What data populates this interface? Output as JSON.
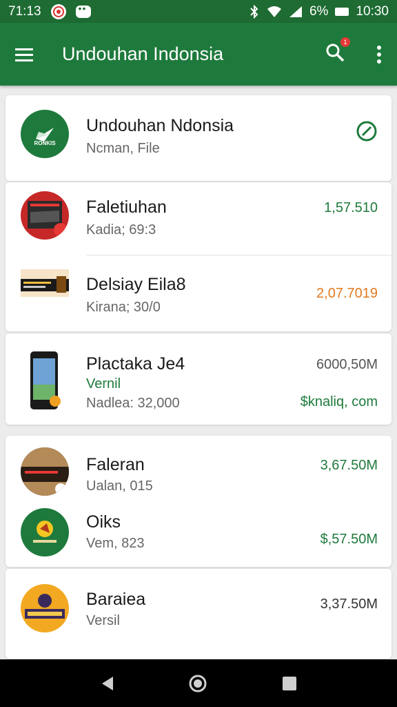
{
  "status_bar": {
    "time_left": "71:13",
    "battery": "6%",
    "time": "10:30"
  },
  "app_bar": {
    "title": "Undouhan Indonsia",
    "search_badge": "1"
  },
  "featured": {
    "name": "Undouhan Ndonsia",
    "subtitle": "Ncman, File",
    "logo_text": "RONKIS"
  },
  "items": [
    {
      "name": "Faletiuhan",
      "subtitle": "Kadia; 69:3",
      "value": "1,57.510",
      "value_color": "#1e7a3c"
    },
    {
      "name": "Delsiay Eila8",
      "subtitle": "Kirana; 30/0",
      "value": "2,07.7019",
      "value_color": "#e07a1f"
    },
    {
      "name": "Plactaka Je4",
      "version": "Vernil",
      "subtitle": "Nadlea: 32,000",
      "value": "6000,50M",
      "link": "$knaliq, com",
      "value_color": "#1e7a3c"
    },
    {
      "name": "Faleran",
      "subtitle": "Ualan, 015",
      "value": "3,67.50M",
      "value_color": "#1e7a3c"
    },
    {
      "name": "Oiks",
      "subtitle": "Vem, 823",
      "value": "$,57.50M",
      "value_color": "#1e7a3c"
    },
    {
      "name": "Baraiea",
      "subtitle": "Versil",
      "value": "3,37.50M",
      "value_color": "#333333"
    }
  ],
  "colors": {
    "primary": "#1e7a3c",
    "status": "#1e6b33",
    "accent_orange": "#e07a1f"
  }
}
